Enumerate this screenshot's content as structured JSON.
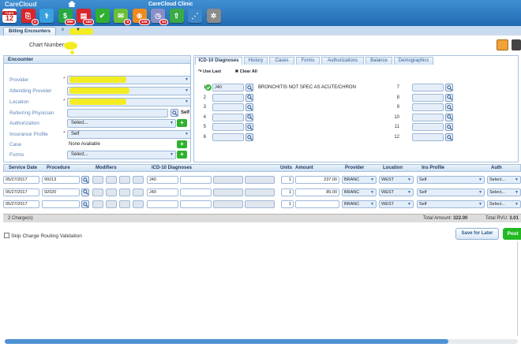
{
  "app": {
    "logo": "CareCloud",
    "clinic": "CareCloud Clinic",
    "calendar_day_label": "TUES",
    "calendar_day": "12"
  },
  "toolbar_icons": [
    {
      "name": "calendar-icon",
      "badge": ""
    },
    {
      "name": "patient-alert-icon",
      "badge": "3"
    },
    {
      "name": "stethoscope-icon",
      "badge": ""
    },
    {
      "name": "billing-dollar-icon",
      "badge": "999"
    },
    {
      "name": "claims-icon",
      "badge": "192"
    },
    {
      "name": "tasks-check-icon",
      "badge": ""
    },
    {
      "name": "messages-icon",
      "badge": "8"
    },
    {
      "name": "payments-icon",
      "badge": "128"
    },
    {
      "name": "scheduler-icon",
      "badge": "34"
    },
    {
      "name": "upload-icon",
      "badge": ""
    },
    {
      "name": "analytics-icon",
      "badge": ""
    },
    {
      "name": "settings-gear-icon",
      "badge": ""
    }
  ],
  "tabs": {
    "billing": "Billing Encounters",
    "close": "x"
  },
  "chart": {
    "label": "Chart Number:"
  },
  "encounter": {
    "title": "Encounter",
    "fields": [
      {
        "label": "Provider",
        "required": "*",
        "value": ""
      },
      {
        "label": "Attending Provider",
        "required": "",
        "value": ""
      },
      {
        "label": "Location",
        "required": "*",
        "value": ""
      },
      {
        "label": "Referring Physician",
        "required": "",
        "value": "",
        "extra": "Self"
      },
      {
        "label": "Authorization",
        "required": "",
        "value": "Select..."
      },
      {
        "label": "Insurance Profile",
        "required": "*",
        "value": "Self"
      },
      {
        "label": "Case",
        "required": "",
        "value": "None Available"
      },
      {
        "label": "Forms",
        "required": "",
        "value": "Select..."
      }
    ]
  },
  "icd": {
    "tabs": [
      "ICD-10 Diagnoses",
      "History",
      "Cases",
      "Forms",
      "Authorizations",
      "Balance",
      "Demographics"
    ],
    "use_last": "Use Last",
    "clear_all": "Clear All",
    "rows_left": [
      {
        "n": "1",
        "code": "J40",
        "desc": "BRONCHITIS NOT SPEC AS ACUTE/CHRON"
      },
      {
        "n": "2",
        "code": "",
        "desc": ""
      },
      {
        "n": "3",
        "code": "",
        "desc": ""
      },
      {
        "n": "4",
        "code": "",
        "desc": ""
      },
      {
        "n": "5",
        "code": "",
        "desc": ""
      },
      {
        "n": "6",
        "code": "",
        "desc": ""
      }
    ],
    "rows_right": [
      "7",
      "8",
      "9",
      "10",
      "11",
      "12"
    ]
  },
  "charges": {
    "headers": [
      "Service Date",
      "Procedure",
      "Modifiers",
      "ICD-10 Diagnoses",
      "Units",
      "Amount",
      "Provider",
      "Location",
      "Ins Profile",
      "Auth"
    ],
    "rows": [
      {
        "date": "05/27/2017",
        "proc": "99213",
        "icd": "J40",
        "units": "1",
        "amount": "237.00",
        "provider": "BRANC",
        "location": "WEST",
        "ins": "Self",
        "auth": "Select..."
      },
      {
        "date": "05/27/2017",
        "proc": "92020",
        "icd": "J40",
        "units": "1",
        "amount": "85.00",
        "provider": "BRANC",
        "location": "WEST",
        "ins": "Self",
        "auth": "Select..."
      },
      {
        "date": "05/27/2017",
        "proc": "",
        "icd": "",
        "units": "1",
        "amount": "",
        "provider": "BRANC",
        "location": "WEST",
        "ins": "Self",
        "auth": "Select..."
      }
    ],
    "count_label": "2 Charge(s)",
    "total_amount_label": "Total Amount:",
    "total_amount": "322.00",
    "total_rvu_label": "Total RVU:",
    "total_rvu": "3.01"
  },
  "footer": {
    "skip_label": "Skip Charge Routing Validation",
    "save_later": "Save for Later",
    "post": "Post"
  },
  "colors": {
    "topbar": "#1f67b0",
    "accent": "#3f8fd2",
    "post": "#23b923",
    "required": "#d43333"
  }
}
